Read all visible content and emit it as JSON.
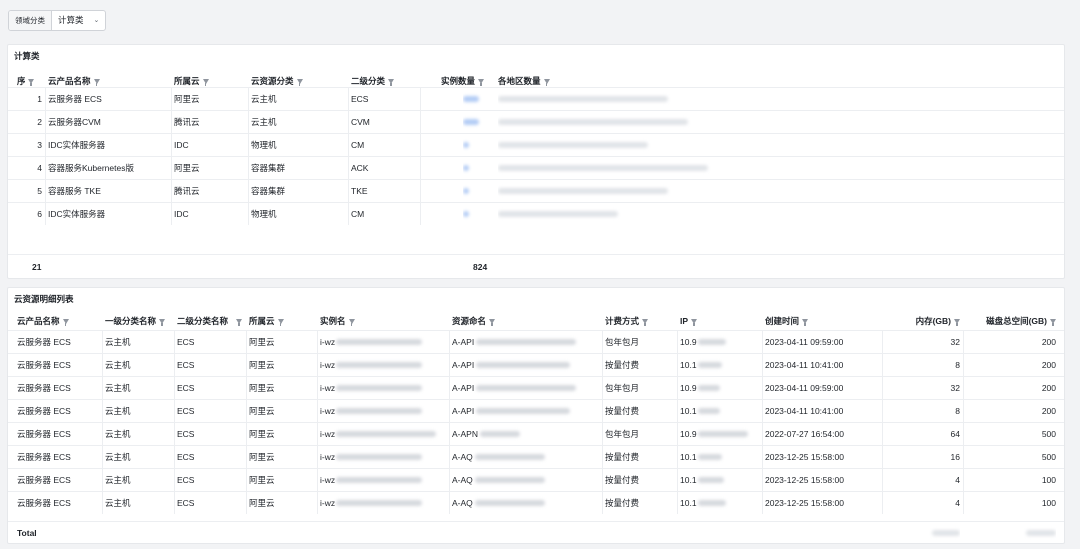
{
  "filter": {
    "label": "领域分类",
    "value": "计算类"
  },
  "compute": {
    "title": "计算类",
    "headers": {
      "seq": "序号",
      "product": "云产品名称",
      "cloud": "所属云",
      "category": "云资源分类",
      "subcategory": "二级分类",
      "count": "实例数量",
      "regions": "各地区数量"
    },
    "rows": [
      {
        "seq": "1",
        "product": "云服务器 ECS",
        "cloud": "阿里云",
        "category": "云主机",
        "subcategory": "ECS"
      },
      {
        "seq": "2",
        "product": "云服务器CVM",
        "cloud": "腾讯云",
        "category": "云主机",
        "subcategory": "CVM"
      },
      {
        "seq": "3",
        "product": "IDC实体服务器",
        "cloud": "IDC",
        "category": "物理机",
        "subcategory": "CM"
      },
      {
        "seq": "4",
        "product": "容器服务Kubernetes版",
        "cloud": "阿里云",
        "category": "容器集群",
        "subcategory": "ACK"
      },
      {
        "seq": "5",
        "product": "容器服务 TKE",
        "cloud": "腾讯云",
        "category": "容器集群",
        "subcategory": "TKE"
      },
      {
        "seq": "6",
        "product": "IDC实体服务器",
        "cloud": "IDC",
        "category": "物理机",
        "subcategory": "CM"
      }
    ],
    "total_rows": "21",
    "total_count": "824"
  },
  "detail": {
    "title": "云资源明细列表",
    "headers": {
      "product": "云产品名称",
      "level1": "一级分类名称",
      "level2": "二级分类名称",
      "cloud": "所属云",
      "instance": "实例名",
      "resource": "资源命名",
      "billing": "计费方式",
      "ip": "IP",
      "created": "创建时间",
      "memory": "内存(GB)",
      "disk": "磁盘总空间(GB)"
    },
    "rows": [
      {
        "product": "云服务器 ECS",
        "level1": "云主机",
        "level2": "ECS",
        "cloud": "阿里云",
        "instance": "i-wz",
        "resource": "A-API",
        "billing": "包年包月",
        "ip": "10.9",
        "created": "2023-04-11 09:59:00",
        "memory": "32",
        "disk": "200"
      },
      {
        "product": "云服务器 ECS",
        "level1": "云主机",
        "level2": "ECS",
        "cloud": "阿里云",
        "instance": "i-wz",
        "resource": "A-API",
        "billing": "按量付费",
        "ip": "10.1",
        "created": "2023-04-11 10:41:00",
        "memory": "8",
        "disk": "200"
      },
      {
        "product": "云服务器 ECS",
        "level1": "云主机",
        "level2": "ECS",
        "cloud": "阿里云",
        "instance": "i-wz",
        "resource": "A-API",
        "billing": "包年包月",
        "ip": "10.9",
        "created": "2023-04-11 09:59:00",
        "memory": "32",
        "disk": "200"
      },
      {
        "product": "云服务器 ECS",
        "level1": "云主机",
        "level2": "ECS",
        "cloud": "阿里云",
        "instance": "i-wz",
        "resource": "A-API",
        "billing": "按量付费",
        "ip": "10.1",
        "created": "2023-04-11 10:41:00",
        "memory": "8",
        "disk": "200"
      },
      {
        "product": "云服务器 ECS",
        "level1": "云主机",
        "level2": "ECS",
        "cloud": "阿里云",
        "instance": "i-wz",
        "resource": "A-APN",
        "billing": "包年包月",
        "ip": "10.9",
        "created": "2022-07-27 16:54:00",
        "memory": "64",
        "disk": "500"
      },
      {
        "product": "云服务器 ECS",
        "level1": "云主机",
        "level2": "ECS",
        "cloud": "阿里云",
        "instance": "i-wz",
        "resource": "A-AQ",
        "billing": "按量付费",
        "ip": "10.1",
        "created": "2023-12-25 15:58:00",
        "memory": "16",
        "disk": "500"
      },
      {
        "product": "云服务器 ECS",
        "level1": "云主机",
        "level2": "ECS",
        "cloud": "阿里云",
        "instance": "i-wz",
        "resource": "A-AQ",
        "billing": "按量付费",
        "ip": "10.1",
        "created": "2023-12-25 15:58:00",
        "memory": "4",
        "disk": "100"
      },
      {
        "product": "云服务器 ECS",
        "level1": "云主机",
        "level2": "ECS",
        "cloud": "阿里云",
        "instance": "i-wz",
        "resource": "A-AQ",
        "billing": "按量付费",
        "ip": "10.1",
        "created": "2023-12-25 15:58:00",
        "memory": "4",
        "disk": "100"
      }
    ],
    "total_label": "Total"
  }
}
